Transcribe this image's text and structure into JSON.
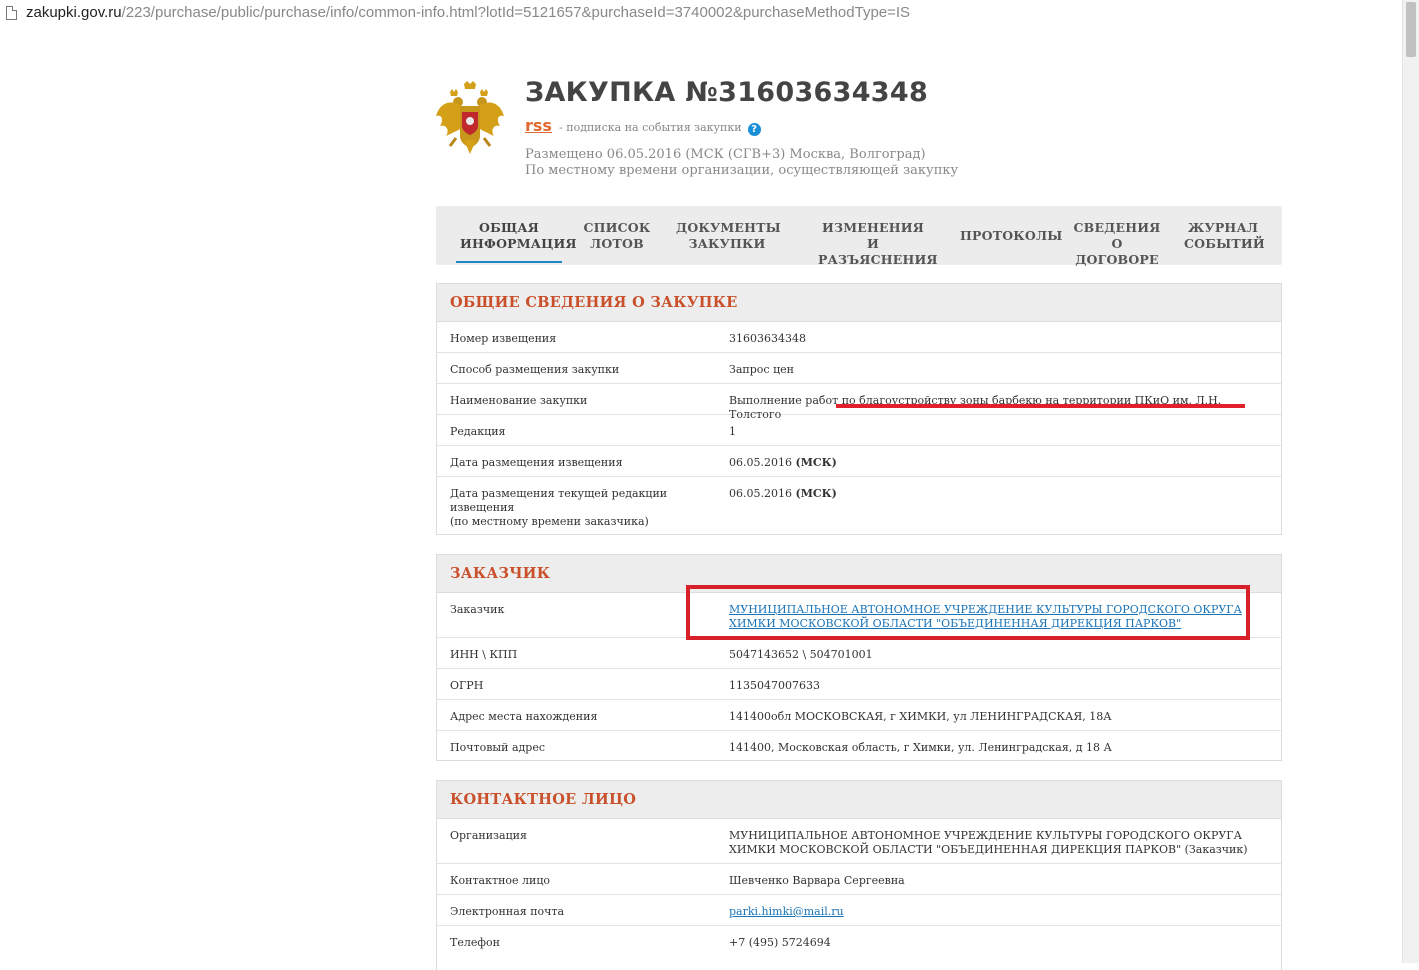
{
  "browser": {
    "url_host": "zakupki.gov.ru",
    "url_path": "/223/purchase/public/purchase/info/common-info.html?lotId=5121657&purchaseId=3740002&purchaseMethodType=IS"
  },
  "header": {
    "title": "ЗАКУПКА №31603634348",
    "rss_label": "rss",
    "rss_subtitle": "- подписка на события закупки",
    "help_glyph": "?",
    "posted_line1": "Размещено 06.05.2016 (МСК (СГВ+3) Москва, Волгоград)",
    "posted_line2": "По местному времени организации, осуществляющей закупку"
  },
  "tabs": [
    {
      "line1": "ОБЩАЯ",
      "line2": "ИНФОРМАЦИЯ"
    },
    {
      "line1": "СПИСОК",
      "line2": "ЛОТОВ"
    },
    {
      "line1": "ДОКУМЕНТЫ",
      "line2": "ЗАКУПКИ"
    },
    {
      "line1": "ИЗМЕНЕНИЯ И",
      "line2": "РАЗЪЯСНЕНИЯ"
    },
    {
      "line1": "ПРОТОКОЛЫ",
      "line2": ""
    },
    {
      "line1": "СВЕДЕНИЯ О",
      "line2": "ДОГОВОРЕ"
    },
    {
      "line1": "ЖУРНАЛ",
      "line2": "СОБЫТИЙ"
    }
  ],
  "general": {
    "heading": "ОБЩИЕ СВЕДЕНИЯ О ЗАКУПКЕ",
    "rows": [
      {
        "label": "Номер извещения",
        "value": "31603634348"
      },
      {
        "label": "Способ размещения закупки",
        "value": "Запрос цен"
      },
      {
        "label": "Наименование закупки",
        "value": "Выполнение работ по благоустройству зоны барбекю на территории ПКиО им. Л.Н. Толстого"
      },
      {
        "label": "Редакция",
        "value": "1"
      },
      {
        "label": "Дата размещения извещения",
        "value": "06.05.2016",
        "value_bold": "(МСК)"
      },
      {
        "label": "Дата размещения текущей редакции извещения",
        "label_note": "(по местному времени заказчика)",
        "value": "06.05.2016",
        "value_bold": "(МСК)"
      }
    ]
  },
  "customer": {
    "heading": "ЗАКАЗЧИК",
    "rows": [
      {
        "label": "Заказчик",
        "value": "МУНИЦИПАЛЬНОЕ АВТОНОМНОЕ УЧРЕЖДЕНИЕ КУЛЬТУРЫ ГОРОДСКОГО ОКРУГА ХИМКИ МОСКОВСКОЙ ОБЛАСТИ \"ОБЪЕДИНЕННАЯ ДИРЕКЦИЯ ПАРКОВ\""
      },
      {
        "label": "ИНН \\ КПП",
        "value": "5047143652 \\ 504701001"
      },
      {
        "label": "ОГРН",
        "value": "1135047007633"
      },
      {
        "label": "Адрес места нахождения",
        "value": "141400обл МОСКОВСКАЯ, г ХИМКИ, ул ЛЕНИНГРАДСКАЯ, 18А"
      },
      {
        "label": "Почтовый адрес",
        "value": "141400, Московская область, г Химки, ул. Ленинградская, д 18 А"
      }
    ]
  },
  "contact": {
    "heading": "КОНТАКТНОЕ ЛИЦО",
    "rows": [
      {
        "label": "Организация",
        "value": "МУНИЦИПАЛЬНОЕ АВТОНОМНОЕ УЧРЕЖДЕНИЕ КУЛЬТУРЫ ГОРОДСКОГО ОКРУГА ХИМКИ МОСКОВСКОЙ ОБЛАСТИ \"ОБЪЕДИНЕННАЯ ДИРЕКЦИЯ ПАРКОВ\" (Заказчик)"
      },
      {
        "label": "Контактное лицо",
        "value": "Шевченко Варвара Сергеевна"
      },
      {
        "label": "Электронная почта",
        "value": "parki.himki@mail.ru"
      },
      {
        "label": "Телефон",
        "value": "+7 (495) 5724694"
      }
    ]
  },
  "colors": {
    "accent_blue": "#1e88c7",
    "section_heading": "#c9502a",
    "annotation_red": "#d8202a"
  }
}
